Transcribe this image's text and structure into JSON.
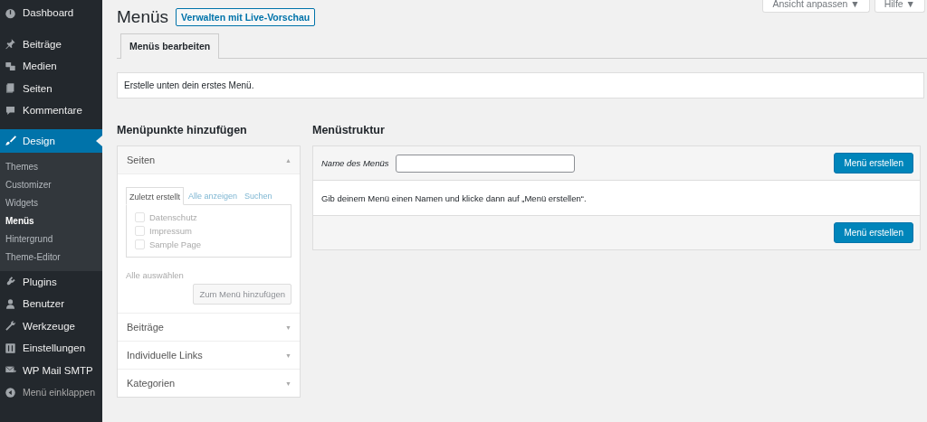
{
  "sidebar": {
    "items": [
      {
        "label": "Dashboard",
        "selected": false
      },
      {
        "label": "Beiträge",
        "selected": false
      },
      {
        "label": "Medien",
        "selected": false
      },
      {
        "label": "Seiten",
        "selected": false
      },
      {
        "label": "Kommentare",
        "selected": false
      },
      {
        "label": "Design",
        "selected": true,
        "children": [
          {
            "label": "Themes",
            "selected": false
          },
          {
            "label": "Customizer",
            "selected": false
          },
          {
            "label": "Widgets",
            "selected": false
          },
          {
            "label": "Menüs",
            "selected": true
          },
          {
            "label": "Hintergrund",
            "selected": false
          },
          {
            "label": "Theme-Editor",
            "selected": false
          }
        ]
      },
      {
        "label": "Plugins",
        "selected": false
      },
      {
        "label": "Benutzer",
        "selected": false
      },
      {
        "label": "Werkzeuge",
        "selected": false
      },
      {
        "label": "Einstellungen",
        "selected": false
      },
      {
        "label": "WP Mail SMTP",
        "selected": false
      }
    ],
    "collapse": "Menü einklappen"
  },
  "screen_options": [
    {
      "label": "Ansicht anpassen",
      "caret": "▼"
    },
    {
      "label": "Hilfe",
      "caret": "▼"
    }
  ],
  "title": "Menüs",
  "live_preview_button": "Verwalten mit Live-Vorschau",
  "tabs": [
    {
      "label": "Menüs bearbeiten",
      "selected": true
    }
  ],
  "notice": "Erstelle unten dein erstes Menü.",
  "add_items": {
    "heading": "Menüpunkte hinzufügen",
    "sections": [
      {
        "title": "Seiten",
        "expanded": true,
        "arrow": "▲",
        "subtabs": [
          {
            "label": "Zuletzt erstellt",
            "selected": true
          },
          {
            "label": "Alle anzeigen",
            "selected": false
          },
          {
            "label": "Suchen",
            "selected": false
          }
        ],
        "pages": [
          {
            "label": "Datenschutz",
            "checked": false
          },
          {
            "label": "Impressum",
            "checked": false
          },
          {
            "label": "Sample Page",
            "checked": false
          }
        ],
        "select_all": "Alle auswählen",
        "add_button": "Zum Menü hinzufügen"
      },
      {
        "title": "Beiträge",
        "expanded": false,
        "arrow": "▼"
      },
      {
        "title": "Individuelle Links",
        "expanded": false,
        "arrow": "▼"
      },
      {
        "title": "Kategorien",
        "expanded": false,
        "arrow": "▼"
      }
    ]
  },
  "structure": {
    "heading": "Menüstruktur",
    "name_label": "Name des Menüs",
    "create_button": "Menü erstellen",
    "hint": "Gib deinem Menü einen Namen und klicke dann auf „Menü erstellen“.",
    "create_button_bottom": "Menü erstellen"
  }
}
